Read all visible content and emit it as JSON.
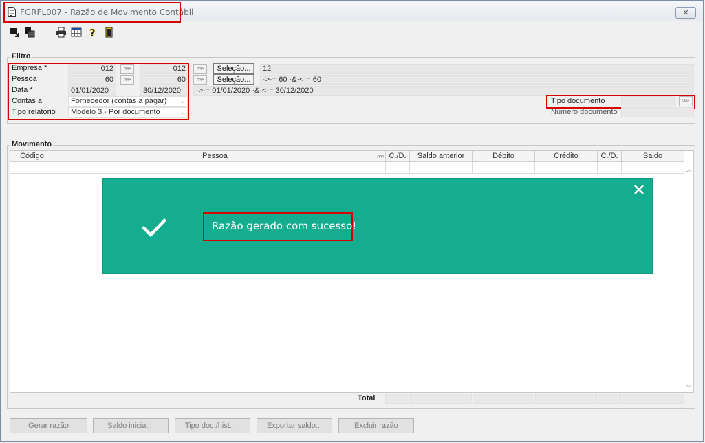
{
  "window": {
    "title": "FGRFL007 - Razão de Movimento Contábil",
    "close_label": "✕"
  },
  "toolbar": {
    "icons": [
      "export-icon",
      "layers-icon",
      "printer-icon",
      "calculator-icon",
      "help-icon",
      "exit-door-icon"
    ]
  },
  "filtro": {
    "group_label": "Filtro",
    "empresa": {
      "label": "Empresa *",
      "from": "012",
      "to": "012",
      "selection_button": "Seleção...",
      "summary": "12"
    },
    "pessoa": {
      "label": "Pessoa",
      "from": "60",
      "to": "60",
      "selection_button": "Seleção...",
      "summary": "·>·= 60 ·&·<·= 60"
    },
    "data": {
      "label": "Data *",
      "from": "01/01/2020",
      "to": "30/12/2020",
      "summary": "·>·= 01/01/2020 ·&·<·= 30/12/2020"
    },
    "contas": {
      "label": "Contas a",
      "value": "Fornecedor (contas a pagar)"
    },
    "tipo_relatorio": {
      "label": "Tipo relatório",
      "value": "Modelo 3 - Por documento"
    },
    "tipo_documento": {
      "label": "Tipo documento",
      "value": ""
    },
    "numero_documento": {
      "label": "Número documento",
      "value": ""
    }
  },
  "movimento": {
    "group_label": "Movimento",
    "columns": [
      "Código",
      "Pessoa",
      "C./D.",
      "Saldo anterior",
      "Débito",
      "Crédito",
      "C./D.",
      "Saldo"
    ],
    "total_label": "Total"
  },
  "toast": {
    "message": "Razão gerado com sucesso!",
    "background": "#14ad8f"
  },
  "actions": {
    "gerar": "Gerar razão",
    "saldo_inicial": "Saldo inicial...",
    "tipo_doc": "Tipo doc./hist. ...",
    "exportar": "Exportar saldo...",
    "excluir": "Excluir razão"
  },
  "colors": {
    "highlight": "#d40000",
    "toast": "#14ad8f",
    "window_bg": "#f0f0f0"
  }
}
